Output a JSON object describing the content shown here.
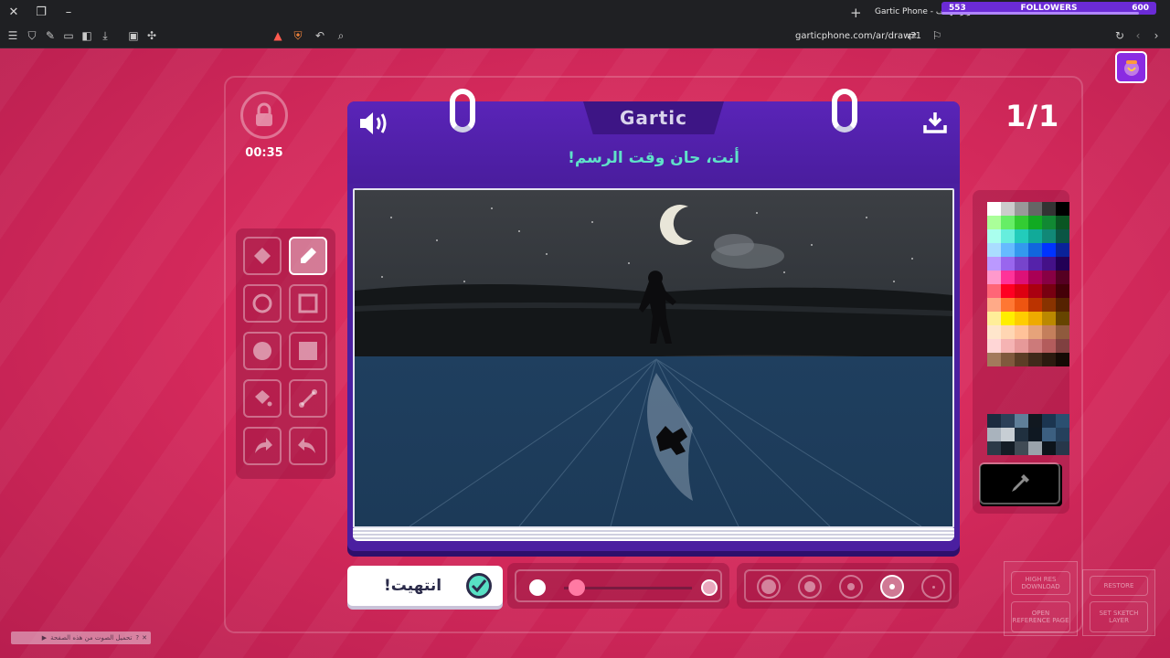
{
  "browser": {
    "tab_title": "Gartic Phone - تصوير الهاتف",
    "tab_extra": "Gartic Phone",
    "url": "garticphone.com/ar/draw?1",
    "followers": {
      "left": "553",
      "label": "FOLLOWERS",
      "right": "600",
      "progress": 0.92
    }
  },
  "game": {
    "timer": "00:35",
    "round": "1/1",
    "logo": "Gartic",
    "prompt": "أنت، حان وقت الرسم!",
    "done_label": "انتهيت!",
    "current_color": "#000000",
    "selected_tool": "pen",
    "selected_size_index": 3,
    "opacity": 0.1
  },
  "palette": {
    "colors": [
      "#ffffff",
      "#cccccc",
      "#999999",
      "#666666",
      "#333333",
      "#000000",
      "#aaff99",
      "#66ee66",
      "#33cc33",
      "#11aa22",
      "#118833",
      "#0a5522",
      "#aaffee",
      "#66eedd",
      "#22ccbb",
      "#11aa99",
      "#118877",
      "#0a5544",
      "#aaddff",
      "#66bbff",
      "#3399ee",
      "#1166dd",
      "#0033ff",
      "#0a2299",
      "#bb99ff",
      "#9966ee",
      "#7744cc",
      "#5522aa",
      "#441188",
      "#220055",
      "#ff99cc",
      "#ff3399",
      "#dd1177",
      "#aa0055",
      "#880044",
      "#550022",
      "#ff6677",
      "#ff0022",
      "#dd0011",
      "#aa0011",
      "#770011",
      "#440008",
      "#ffaa88",
      "#ff7733",
      "#ee5511",
      "#bb3300",
      "#883300",
      "#552200",
      "#ffee99",
      "#ffee00",
      "#ffcc00",
      "#eeaa00",
      "#bb8800",
      "#664400",
      "#ffe6cc",
      "#ffd6b3",
      "#ffc299",
      "#e6a37a",
      "#c47f5c",
      "#8f5a3d",
      "#ffd6d6",
      "#f5b3b3",
      "#e69999",
      "#cc7a7a",
      "#b35c5c",
      "#804040",
      "#a37a5c",
      "#80593d",
      "#5c3d26",
      "#40291a",
      "#2b1a0f",
      "#140a05"
    ],
    "recent": [
      "#1b2b3f",
      "#2b4058",
      "#5f7f99",
      "#111820",
      "#1b3550",
      "#2b4f70",
      "#a9b3bd",
      "#c7ced4",
      "#20303f",
      "#0f1822",
      "#3c5f80",
      "#25405c",
      "#2b3a48",
      "#141d26",
      "#404b55",
      "#9aa3ab",
      "#0d141b",
      "#27374a"
    ]
  },
  "extension": {
    "high_res": "HIGH RES DOWNLOAD",
    "open_ref": "OPEN REFERENCE PAGE",
    "restore": "RESTORE",
    "sketch": "SET SKETCH LAYER"
  },
  "notice": "تحميل الصوت من هذه الصفحة"
}
